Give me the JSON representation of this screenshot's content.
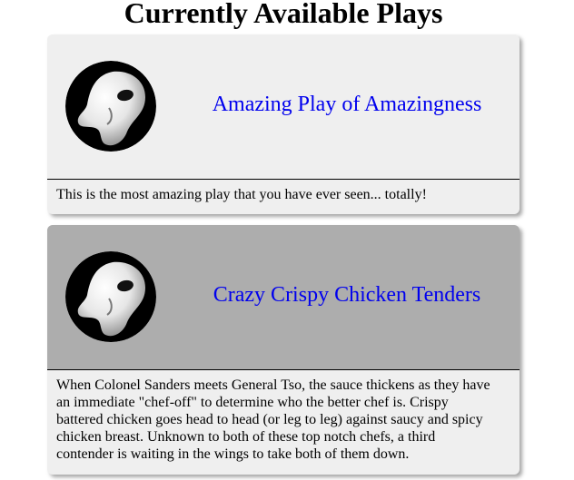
{
  "page": {
    "title": "Currently Available Plays"
  },
  "plays": [
    {
      "title": "Amazing Play of Amazingness",
      "description": "This is the most amazing play that you have ever seen... totally!",
      "icon": "phantom-mask-icon",
      "header_color": "#efefef"
    },
    {
      "title": "Crazy Crispy Chicken Tenders",
      "description": "When Colonel Sanders meets General Tso, the sauce thickens as they have an immediate \"chef-off\" to determine who the better chef is. Crispy battered chicken goes head to head (or leg to leg) against saucy and spicy chicken breast. Unknown to both of these top notch chefs, a third contender is waiting in the wings to take both of them down.",
      "icon": "phantom-mask-icon",
      "header_color": "#adadad"
    }
  ],
  "colors": {
    "link": "#0000ee",
    "card_background": "#efefef",
    "highlight_header": "#adadad"
  }
}
